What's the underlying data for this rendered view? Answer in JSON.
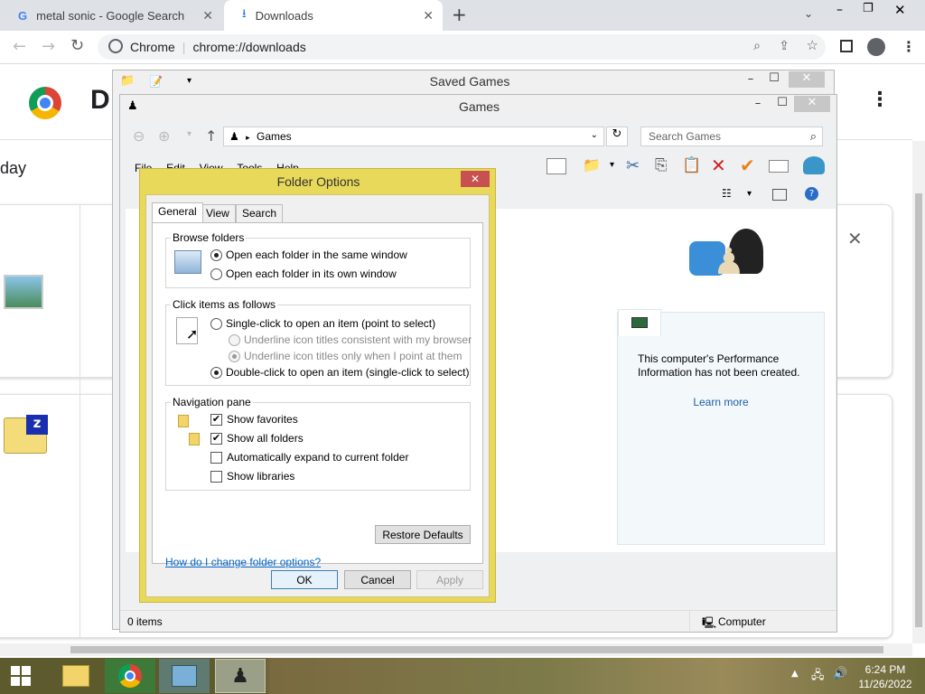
{
  "browser": {
    "tabs": [
      {
        "label": "metal sonic - Google Search"
      },
      {
        "label": "Downloads"
      }
    ],
    "new_tab": "+",
    "omnibox": {
      "site": "Chrome",
      "url": "chrome://downloads"
    }
  },
  "downloads_page": {
    "title_initial": "D",
    "date_fragment": "day",
    "close_glyph": "✕"
  },
  "saved_games_window": {
    "title": "Saved Games"
  },
  "games_window": {
    "title": "Games",
    "breadcrumb": "Games",
    "search_placeholder": "Search Games",
    "menu": [
      "File",
      "Edit",
      "View",
      "Tools",
      "Help"
    ],
    "perf_text": "This computer's Performance Information has not been created.",
    "learn_more": "Learn more",
    "status_items": "0 items",
    "status_location": "Computer"
  },
  "folder_options": {
    "title": "Folder Options",
    "tabs": [
      "General",
      "View",
      "Search"
    ],
    "browse_folders": {
      "label": "Browse folders",
      "options": [
        "Open each folder in the same window",
        "Open each folder in its own window"
      ],
      "selected": 0
    },
    "click_items": {
      "label": "Click items as follows",
      "single": "Single-click to open an item (point to select)",
      "sub": [
        "Underline icon titles consistent with my browser",
        "Underline icon titles only when I point at them"
      ],
      "double": "Double-click to open an item (single-click to select)"
    },
    "nav_pane": {
      "label": "Navigation pane",
      "options": [
        {
          "label": "Show favorites",
          "checked": true
        },
        {
          "label": "Show all folders",
          "checked": true
        },
        {
          "label": "Automatically expand to current folder",
          "checked": false
        },
        {
          "label": "Show libraries",
          "checked": false
        }
      ]
    },
    "restore_defaults": "Restore Defaults",
    "help_link": "How do I change folder options?",
    "ok": "OK",
    "cancel": "Cancel",
    "apply": "Apply"
  },
  "taskbar": {
    "time": "6:24 PM",
    "date": "11/26/2022"
  },
  "colors": {
    "dialog_frame": "#e8d95a",
    "chrome_tabstrip": "#dee1e6",
    "link": "#0066cc",
    "taskbar": "#6b6434"
  }
}
